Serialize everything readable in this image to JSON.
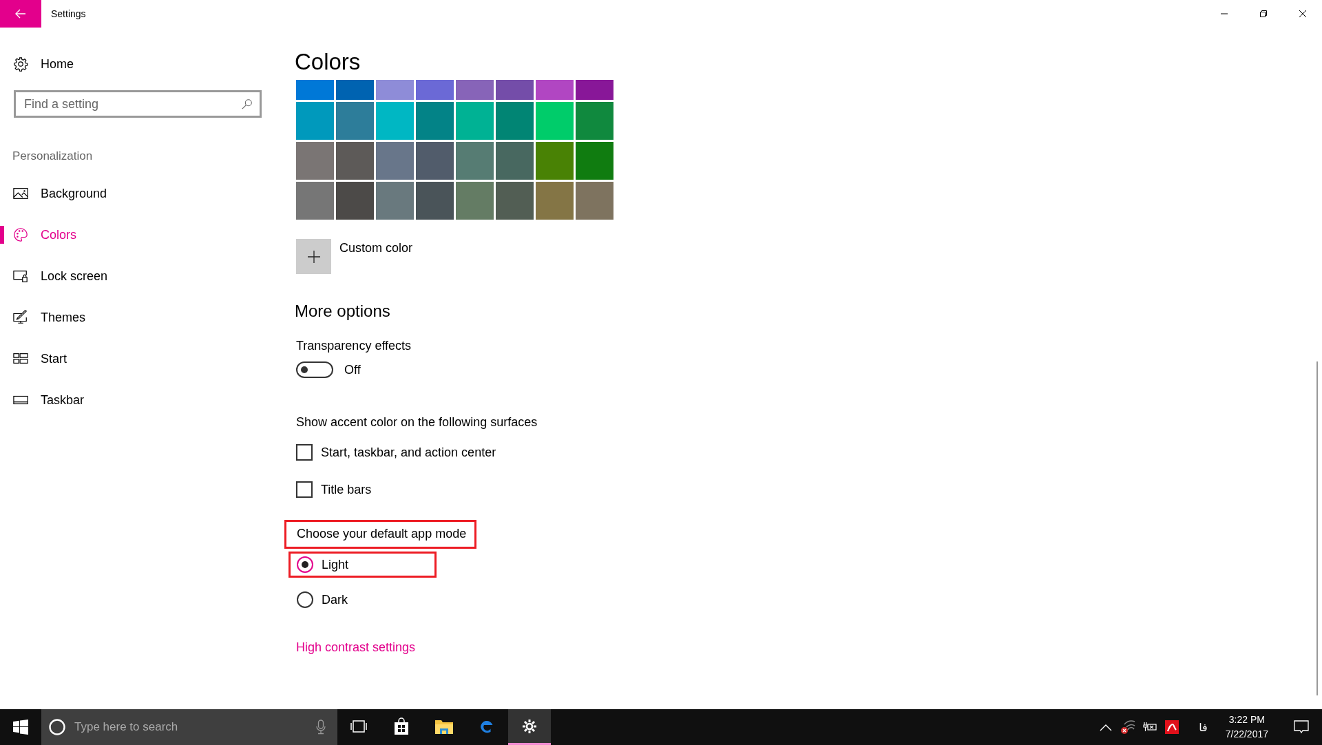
{
  "window": {
    "title": "Settings"
  },
  "sidebar": {
    "home": "Home",
    "search": {
      "placeholder": "Find a setting"
    },
    "section": "Personalization",
    "items": [
      {
        "kind": "background",
        "label": "Background",
        "selected": false
      },
      {
        "kind": "colors",
        "label": "Colors",
        "selected": true
      },
      {
        "kind": "lock",
        "label": "Lock screen",
        "selected": false
      },
      {
        "kind": "themes",
        "label": "Themes",
        "selected": false
      },
      {
        "kind": "start",
        "label": "Start",
        "selected": false
      },
      {
        "kind": "taskbar",
        "label": "Taskbar",
        "selected": false
      }
    ]
  },
  "content": {
    "title": "Colors",
    "swatches": [
      {
        "color": "#0078d7"
      },
      {
        "color": "#0063b1"
      },
      {
        "color": "#8e8cd8"
      },
      {
        "color": "#6b69d6"
      },
      {
        "color": "#8764b8"
      },
      {
        "color": "#744da9"
      },
      {
        "color": "#b146c2"
      },
      {
        "color": "#881798"
      },
      {
        "color": "#0099bc"
      },
      {
        "color": "#2d7d9a"
      },
      {
        "color": "#00b7c3"
      },
      {
        "color": "#038387"
      },
      {
        "color": "#00b294"
      },
      {
        "color": "#018574"
      },
      {
        "color": "#00cc6a"
      },
      {
        "color": "#10893e"
      },
      {
        "color": "#7a7574"
      },
      {
        "color": "#5d5a58"
      },
      {
        "color": "#68768a"
      },
      {
        "color": "#515c6b"
      },
      {
        "color": "#567c73"
      },
      {
        "color": "#486860"
      },
      {
        "color": "#498205"
      },
      {
        "color": "#107c10"
      },
      {
        "color": "#767676"
      },
      {
        "color": "#4c4a48"
      },
      {
        "color": "#69797e"
      },
      {
        "color": "#4a5459"
      },
      {
        "color": "#647c64"
      },
      {
        "color": "#525e54"
      },
      {
        "color": "#847545"
      },
      {
        "color": "#7e735f"
      }
    ],
    "custom_color": "Custom color",
    "more_options": "More options",
    "transparency": {
      "label": "Transparency effects",
      "on": false,
      "state_text": "Off"
    },
    "accent_heading": "Show accent color on the following surfaces",
    "checkboxes": [
      {
        "label": "Start, taskbar, and action center",
        "checked": false
      },
      {
        "label": "Title bars",
        "checked": false
      }
    ],
    "app_mode": {
      "label": "Choose your default app mode",
      "highlighted": true,
      "options": [
        {
          "label": "Light",
          "selected": true,
          "highlighted": true
        },
        {
          "label": "Dark",
          "selected": false,
          "highlighted": false
        }
      ]
    },
    "link": "High contrast settings"
  },
  "taskbar": {
    "search": {
      "placeholder": "Type here to search"
    },
    "apps": [
      {
        "kind": "task-view",
        "selected": false
      },
      {
        "kind": "store",
        "selected": false
      },
      {
        "kind": "explorer",
        "selected": false
      },
      {
        "kind": "edge",
        "selected": false
      },
      {
        "kind": "settings",
        "selected": true
      }
    ],
    "tray": {
      "language": "فا",
      "time": "3:22 PM",
      "date": "7/22/2017"
    }
  }
}
